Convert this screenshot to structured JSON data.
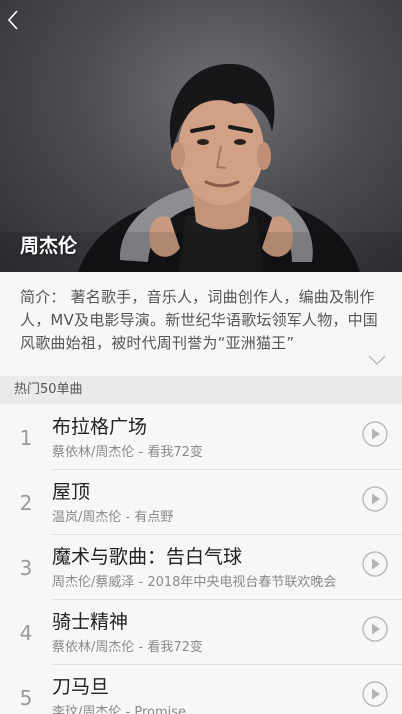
{
  "artist": {
    "name": "周杰伦"
  },
  "intro": {
    "text": "简介： 著名歌手，音乐人，词曲创作人，编曲及制作人，MV及电影导演。新世纪华语歌坛领军人物，中国风歌曲始祖，被时代周刊誉为“亚洲猫王”"
  },
  "hot_songs": {
    "title": "热门50单曲",
    "items": [
      {
        "index": "1",
        "title": "布拉格广场",
        "meta": "蔡依林/周杰伦 - 看我72变"
      },
      {
        "index": "2",
        "title": "屋顶",
        "meta": "温岚/周杰伦 - 有点野"
      },
      {
        "index": "3",
        "title": "魔术与歌曲：告白气球",
        "meta": "周杰伦/蔡威泽 - 2018年中央电视台春节联欢晚会"
      },
      {
        "index": "4",
        "title": "骑士精神",
        "meta": "蔡依林/周杰伦 - 看我72变"
      },
      {
        "index": "5",
        "title": "刀马旦",
        "meta": "李玟/周杰伦 - Promise"
      }
    ]
  },
  "icons": {
    "back": "chevron-left-icon",
    "expand": "chevron-down-icon",
    "play": "play-circle-icon"
  },
  "colors": {
    "hero_bg": "#4c4d52",
    "list_bg": "#f7f7f7",
    "section_bg": "#eaeaea",
    "icon_gray": "#b5b5b5"
  }
}
